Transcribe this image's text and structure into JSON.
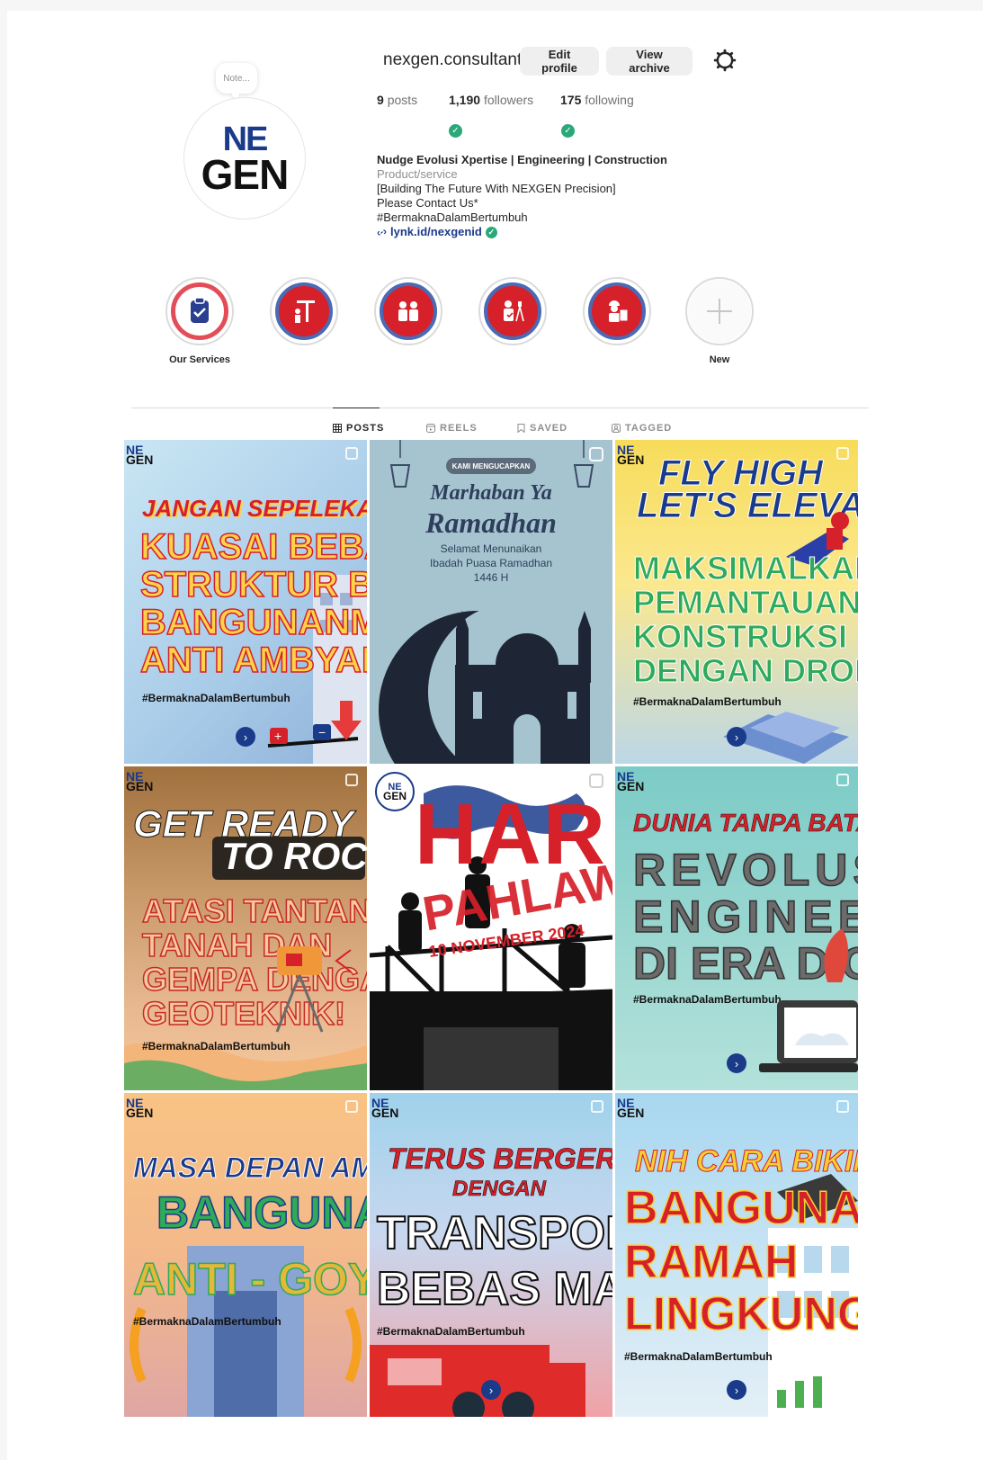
{
  "profile": {
    "username": "nexgen.consultant",
    "note_placeholder": "Note...",
    "avatar_logo_top": "NE",
    "avatar_logo_bottom": "GEN",
    "edit_profile_label": "Edit profile",
    "view_archive_label": "View archive",
    "posts_count": "9",
    "posts_label": "posts",
    "followers_count": "1,190",
    "followers_label": "followers",
    "following_count": "175",
    "following_label": "following",
    "bio_name": "Nudge Evolusi Xpertise | Engineering | Construction",
    "bio_category": "Product/service",
    "bio_line1": "[Building The Future With NEXGEN Precision]",
    "bio_line2": "Please Contact Us*",
    "bio_line3": "#BermaknaDalamBertumbuh",
    "bio_link": "lynk.id/nexgenid"
  },
  "highlights": [
    {
      "label": "Our Services"
    },
    {
      "label": ""
    },
    {
      "label": ""
    },
    {
      "label": ""
    },
    {
      "label": ""
    },
    {
      "label": "New"
    }
  ],
  "tabs": [
    {
      "label": "POSTS"
    },
    {
      "label": "REELS"
    },
    {
      "label": "SAVED"
    },
    {
      "label": "TAGGED"
    }
  ],
  "posts": [
    {
      "headline": "JANGAN SEPELEKAN",
      "body1": "KUASAI BEBAN",
      "body2": "STRUKTUR BIAR",
      "body3": "BANGUNANMU",
      "body4": "ANTI AMBYAR!",
      "hashtag": "#BermaknaDalamBertumbuh",
      "logo_top": "NE",
      "logo_bottom": "GEN"
    },
    {
      "badge": "KAMI MENGUCAPKAN",
      "line1": "Marhaban Ya",
      "line2": "Ramadhan",
      "sub1": "Selamat Menunaikan",
      "sub2": "Ibadah Puasa Ramadhan",
      "sub3": "1446 H"
    },
    {
      "headline1": "FLY HIGH",
      "headline2": "LET'S ELEVATE!",
      "body1": "MAKSIMALKAN",
      "body2": "PEMANTAUAN",
      "body3": "KONSTRUKSI",
      "body4": "DENGAN DRONE!",
      "hashtag": "#BermaknaDalamBertumbuh",
      "logo_top": "NE",
      "logo_bottom": "GEN"
    },
    {
      "headline1": "GET READY",
      "headline2": "TO ROCK",
      "body1": "ATASI TANTANGAN",
      "body2": "TANAH DAN",
      "body3": "GEMPA DENGAN",
      "body4": "GEOTEKNIK!",
      "hashtag": "#BermaknaDalamBertumbuh",
      "logo_top": "NE",
      "logo_bottom": "GEN"
    },
    {
      "headline1": "HARI",
      "headline2": "PAHLAWAN",
      "date": "10 NOVEMBER 2024",
      "logo_top": "NE",
      "logo_bottom": "GEN"
    },
    {
      "headline": "DUNIA TANPA BATAS",
      "body1": "REVOLUSI",
      "body2": "ENGINEER",
      "body3": "DI ERA DIGITAL",
      "hashtag": "#BermaknaDalamBertumbuh",
      "logo_top": "NE",
      "logo_bottom": "GEN"
    },
    {
      "headline": "MASA DEPAN AMAN",
      "body1": "BANGUNAN",
      "body2": "ANTI - GOYANG",
      "hashtag": "#BermaknaDalamBertumbuh",
      "logo_top": "NE",
      "logo_bottom": "GEN"
    },
    {
      "headline1": "TERUS BERGERAK",
      "headline2": "DENGAN",
      "body1": "TRANSPORTASI",
      "body2": "BEBAS MACET",
      "hashtag": "#BermaknaDalamBertumbuh",
      "logo_top": "NE",
      "logo_bottom": "GEN"
    },
    {
      "headline": "NIH CARA BIKIN",
      "body1": "BANGUNAN",
      "body2": "RAMAH",
      "body3": "LINGKUNGAN!",
      "hashtag": "#BermaknaDalamBertumbuh",
      "logo_top": "NE",
      "logo_bottom": "GEN"
    }
  ],
  "colors": {
    "brand_blue": "#1a3a8a",
    "verified_green": "#2ba87a",
    "highlight_red": "#d6202a"
  }
}
